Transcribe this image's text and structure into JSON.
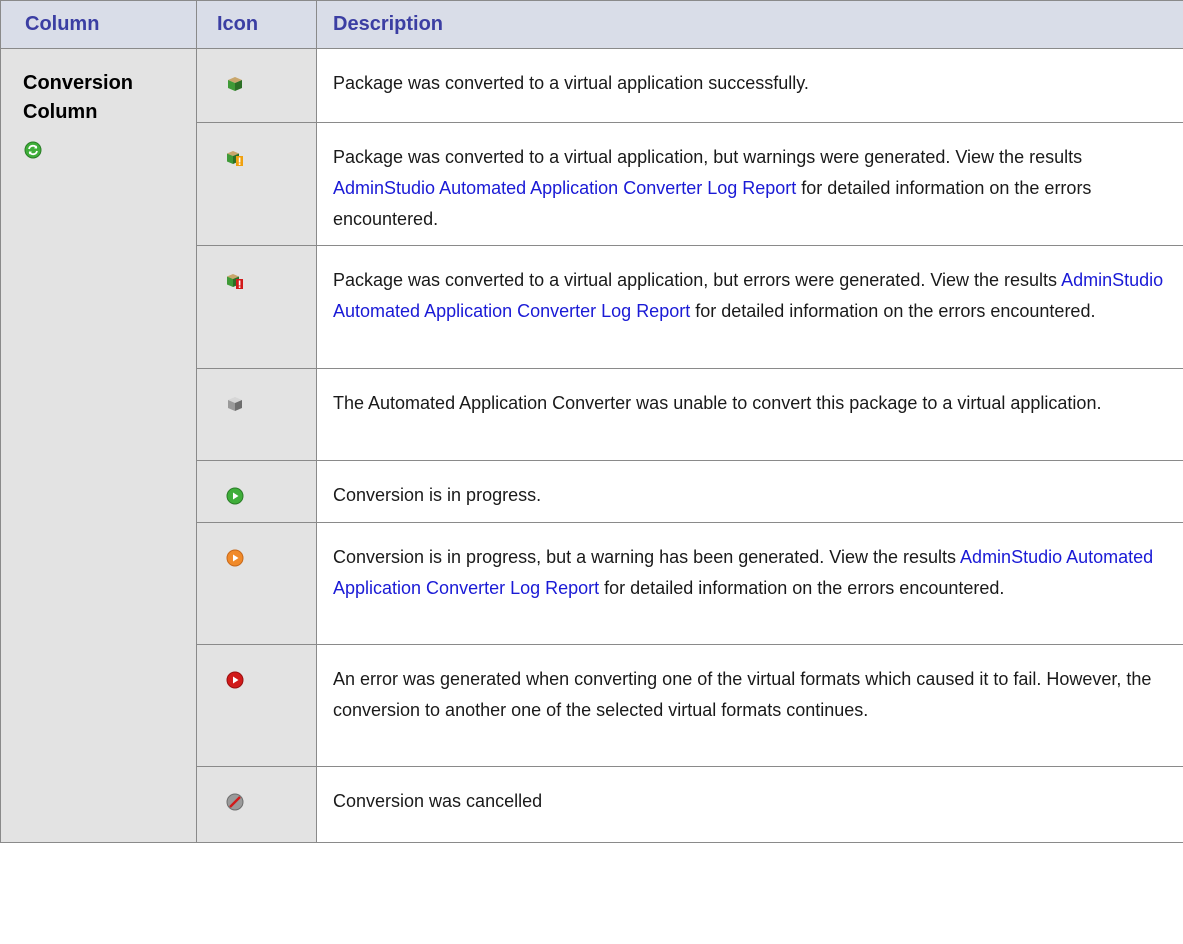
{
  "table": {
    "headers": {
      "column": "Column",
      "icon": "Icon",
      "description": "Description"
    },
    "column_name_line1": "Conversion",
    "column_name_line2": "Column",
    "column_icon": "refresh-circle-icon",
    "rows": [
      {
        "icon": "package-success-icon",
        "parts": [
          "Package was converted to a virtual application successfully."
        ]
      },
      {
        "icon": "package-warning-icon",
        "parts": [
          "Package was converted to a virtual application, but warnings were generated. View the results ",
          "AdminStudio Automated Application Converter Log Report",
          " for detailed information on the errors encountered."
        ]
      },
      {
        "icon": "package-error-icon",
        "parts": [
          "Package was converted to a virtual application, but errors were generated. View the results ",
          "AdminStudio Automated Application Converter Log Report",
          " for detailed information on the errors encountered."
        ]
      },
      {
        "icon": "package-failed-icon",
        "parts": [
          "The Automated Application Converter was unable to convert this package to a virtual application."
        ]
      },
      {
        "icon": "play-green-icon",
        "parts": [
          "Conversion is in progress."
        ]
      },
      {
        "icon": "play-orange-icon",
        "parts": [
          "Conversion is in progress, but a warning has been generated. View the results ",
          "AdminStudio Automated Application Converter Log Report",
          " for detailed information on the errors encountered."
        ]
      },
      {
        "icon": "play-red-icon",
        "parts": [
          "An error was generated when converting one of the virtual formats which caused it to fail. However, the conversion to another one of the selected virtual formats continues."
        ]
      },
      {
        "icon": "cancelled-icon",
        "parts": [
          "Conversion was cancelled"
        ]
      }
    ]
  },
  "colors": {
    "header_text": "#3b3ea3",
    "header_bg": "#d9dde8",
    "link": "#1a1ad6",
    "cell_gray": "#e3e3e3"
  }
}
